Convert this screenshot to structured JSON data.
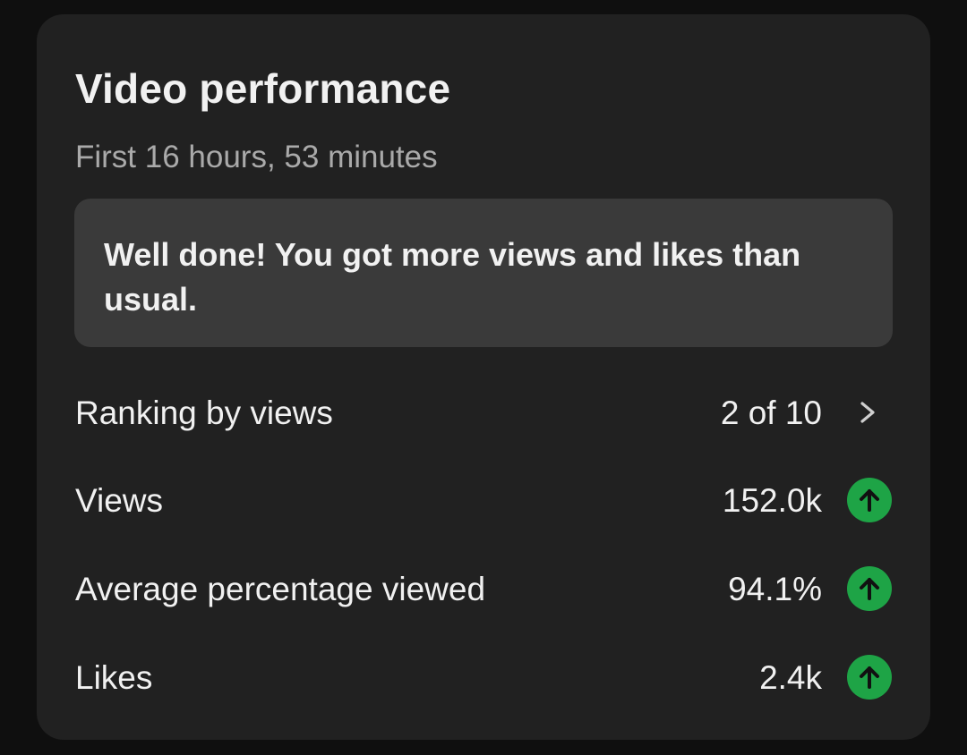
{
  "card": {
    "title": "Video performance",
    "subtitle": "First 16 hours, 53 minutes",
    "banner": "Well done! You got more views and likes than usual."
  },
  "metrics": [
    {
      "label": "Ranking by views",
      "value": "2 of 10",
      "icon": "chevron-right-icon"
    },
    {
      "label": "Views",
      "value": "152.0k",
      "icon": "arrow-up-icon",
      "trend": "up"
    },
    {
      "label": "Average percentage viewed",
      "value": "94.1%",
      "icon": "arrow-up-icon",
      "trend": "up"
    },
    {
      "label": "Likes",
      "value": "2.4k",
      "icon": "arrow-up-icon",
      "trend": "up"
    }
  ],
  "colors": {
    "background": "#0f0f0f",
    "card": "#212121",
    "banner": "#3a3a3a",
    "trend_up": "#1ea446"
  }
}
